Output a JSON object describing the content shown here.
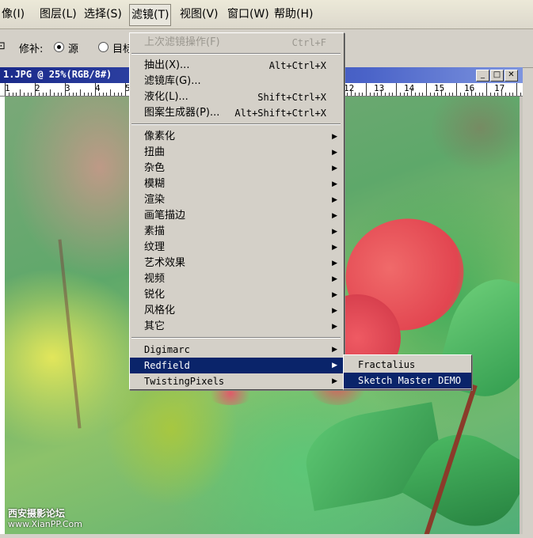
{
  "menubar": {
    "items": [
      "像(I)",
      "图层(L)",
      "选择(S)",
      "滤镜(T)",
      "视图(V)",
      "窗口(W)",
      "帮助(H)"
    ]
  },
  "options": {
    "patch_label": "修补:",
    "source_label": "源",
    "target_label": "目标",
    "source_selected": true
  },
  "document": {
    "title": "1.JPG @ 25%(RGB/8#)",
    "ruler_numbers": [
      "1",
      "2",
      "3",
      "4",
      "5",
      "12",
      "13",
      "14",
      "15",
      "16",
      "17"
    ]
  },
  "filter_menu": {
    "items": [
      {
        "label": "上次滤镜操作(F)",
        "shortcut": "Ctrl+F",
        "disabled": true
      },
      {
        "label": "抽出(X)...",
        "shortcut": "Alt+Ctrl+X"
      },
      {
        "label": "滤镜库(G)..."
      },
      {
        "label": "液化(L)...",
        "shortcut": "Shift+Ctrl+X"
      },
      {
        "label": "图案生成器(P)...",
        "shortcut": "Alt+Shift+Ctrl+X"
      },
      {
        "label": "像素化",
        "submenu": true
      },
      {
        "label": "扭曲",
        "submenu": true
      },
      {
        "label": "杂色",
        "submenu": true
      },
      {
        "label": "模糊",
        "submenu": true
      },
      {
        "label": "渲染",
        "submenu": true
      },
      {
        "label": "画笔描边",
        "submenu": true
      },
      {
        "label": "素描",
        "submenu": true
      },
      {
        "label": "纹理",
        "submenu": true
      },
      {
        "label": "艺术效果",
        "submenu": true
      },
      {
        "label": "视频",
        "submenu": true
      },
      {
        "label": "锐化",
        "submenu": true
      },
      {
        "label": "风格化",
        "submenu": true
      },
      {
        "label": "其它",
        "submenu": true
      },
      {
        "label": "Digimarc",
        "submenu": true
      },
      {
        "label": "Redfield",
        "submenu": true,
        "highlighted": true
      },
      {
        "label": "TwistingPixels",
        "submenu": true
      }
    ]
  },
  "redfield_submenu": {
    "items": [
      {
        "label": "Fractalius"
      },
      {
        "label": "Sketch Master DEMO",
        "highlighted": true
      }
    ]
  },
  "watermark": {
    "line1": "西安摄影论坛",
    "line2": "www.XianPP.Com"
  },
  "colors": {
    "menu_highlight": "#0a246a",
    "title_bar": "#1a2a8a",
    "menu_bg": "#d4d0c8"
  }
}
